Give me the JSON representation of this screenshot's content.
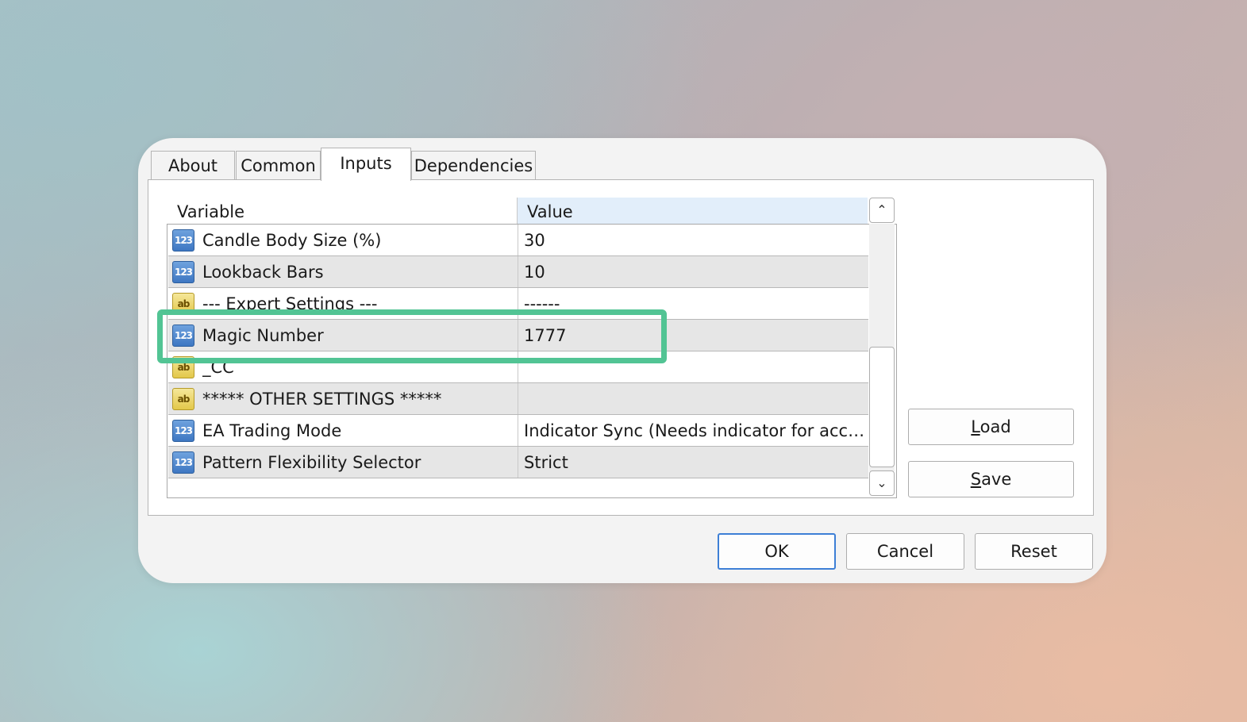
{
  "tabs": [
    {
      "label": "About"
    },
    {
      "label": "Common"
    },
    {
      "label": "Inputs"
    },
    {
      "label": "Dependencies"
    }
  ],
  "active_tab": "Inputs",
  "grid": {
    "header_variable": "Variable",
    "header_value": "Value",
    "rows": [
      {
        "icon": "123",
        "variable": "Candle Body Size (%)",
        "value": "30"
      },
      {
        "icon": "123",
        "variable": "Lookback Bars",
        "value": "10"
      },
      {
        "icon": "ab",
        "variable": "--- Expert Settings ---",
        "value": "------"
      },
      {
        "icon": "123",
        "variable": "Magic Number",
        "value": "1777"
      },
      {
        "icon": "ab",
        "variable": "_CC",
        "value": ""
      },
      {
        "icon": "ab",
        "variable": "***** OTHER SETTINGS *****",
        "value": ""
      },
      {
        "icon": "123",
        "variable": "EA Trading Mode",
        "value": "Indicator Sync (Needs indicator for accuracy)"
      },
      {
        "icon": "123",
        "variable": "Pattern Flexibility Selector",
        "value": "Strict"
      }
    ],
    "highlighted_variable": "Magic Number",
    "highlight_color": "#52c494"
  },
  "side_buttons": {
    "load": {
      "underline": "L",
      "rest": "oad"
    },
    "save": {
      "underline": "S",
      "rest": "ave"
    }
  },
  "footer_buttons": {
    "ok": "OK",
    "cancel": "Cancel",
    "reset": "Reset"
  },
  "icons": {
    "scroll_up": "chevron-up-icon",
    "scroll_down": "chevron-down-icon",
    "number_type": "integer-type-icon",
    "string_type": "string-type-icon"
  }
}
